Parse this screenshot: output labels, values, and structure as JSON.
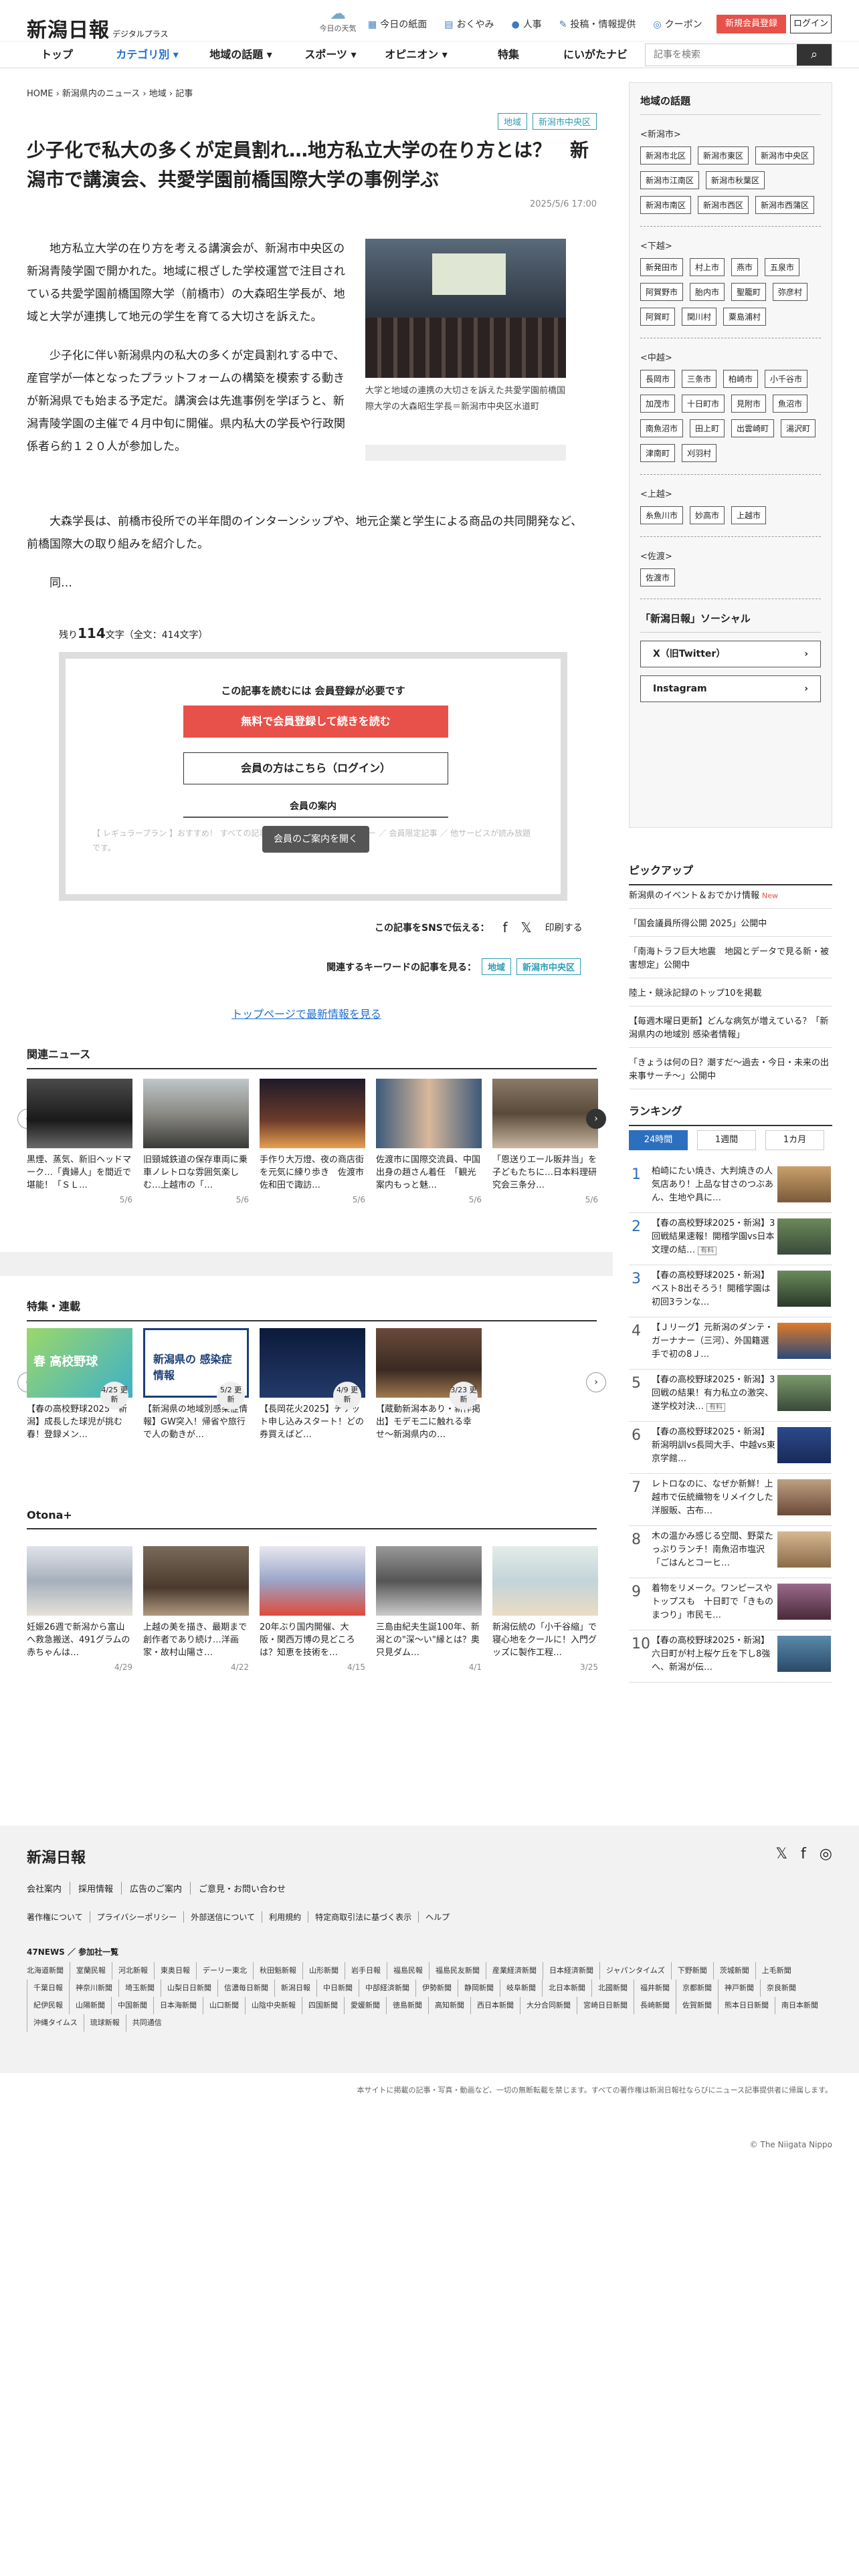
{
  "header": {
    "logo": "新潟日報",
    "logo_sub": "デジタルプラス",
    "weather": "今日の天気",
    "links": [
      {
        "icon": "▦",
        "label": "今日の紙面"
      },
      {
        "icon": "▤",
        "label": "おくやみ"
      },
      {
        "icon": "●",
        "label": "人事"
      },
      {
        "icon": "✎",
        "label": "投稿・情報提供"
      },
      {
        "icon": "◎",
        "label": "クーポン"
      }
    ],
    "register": "新規会員登録",
    "login": "ログイン"
  },
  "nav": {
    "items": [
      "トップ",
      "カテゴリ別 ▾",
      "地域の話題 ▾",
      "スポーツ ▾",
      "オピニオン ▾",
      "特集",
      "にいがたナビ"
    ],
    "search_placeholder": "記事を検索",
    "search_icon": "search-icon"
  },
  "article": {
    "breadcrumb": [
      "HOME",
      "新潟県内のニュース",
      "地域",
      "記事"
    ],
    "tags": [
      "地域",
      "新潟市中央区"
    ],
    "title": "少子化で私大の多くが定員割れ…地方私立大学の在り方とは？　新潟市で講演会、共愛学園前橋国際大学の事例学ぶ",
    "date": "2025/5/6 17:00",
    "p1": "地方私立大学の在り方を考える講演会が、新潟市中央区の新潟青陵学園で開かれた。地域に根ざした学校運営で注目されている共愛学園前橋国際大学（前橋市）の大森昭生学長が、地域と大学が連携して地元の学生を育てる大切さを訴えた。",
    "p2": "少子化に伴い新潟県内の私大の多くが定員割れする中で、産官学が一体となったプラットフォームの構築を模索する動きが新潟県でも始まる予定だ。講演会は先進事例を学ぼうと、新潟青陵学園の主催で４月中旬に開催。県内私大の学長や行政関係者ら約１２０人が参加した。",
    "p3": "大森学長は、前橋市役所での半年間のインターンシップや、地元企業と学生による商品の共同開発など、前橋国際大の取り組みを紹介した。",
    "p4": "同…",
    "caption": "大学と地域の連携の大切さを訴えた共愛学園前橋国際大学の大森昭生学長＝新潟市中央区水道町",
    "remain_label": "残り",
    "remain": "114",
    "remain_unit": "文字",
    "total": "（全文：414文字）"
  },
  "paywall": {
    "heading": "この記事を読むには 会員登録が必要です",
    "register_btn": "無料で会員登録して続きを読む",
    "login_btn": "会員の方はこちら（ログイン）",
    "guide": "会員の案内",
    "faded": "【 レギュラープラン 】おすすめ！ すべての記事が読み放題 ／ 紙面ビューアー ／ 会員限定記事 ／ 他サービスが読み放題です。",
    "open_btn": "会員のご案内を開く"
  },
  "share": {
    "label": "この記事をSNSで伝える：",
    "fb": "f",
    "x": "𝕏",
    "print": "印刷する"
  },
  "keywords": {
    "label": "関連するキーワードの記事を見る：",
    "items": [
      "地域",
      "新潟市中央区"
    ]
  },
  "toplink": "トップページで最新情報を見る",
  "related": {
    "heading": "関連ニュース",
    "items": [
      {
        "text": "黒煙、蒸気、新旧ヘッドマーク…「貴婦人」を間近で堪能！「ＳＬ…",
        "date": "5/6"
      },
      {
        "text": "旧頸城鉄道の保存車両に乗車ノレトロな雰囲気楽しむ…上越市の「…",
        "date": "5/6"
      },
      {
        "text": "手作り大万燈、夜の商店街を元気に練り歩き　佐渡市佐和田で諏訪…",
        "date": "5/6"
      },
      {
        "text": "佐渡市に国際交流員、中国出身の趙さん着任　「観光案内もっと魅…",
        "date": "5/6"
      },
      {
        "text": "「恩送りエール販井当」を子どもたちに…日本料理研究会三条分…",
        "date": "5/6"
      }
    ]
  },
  "features": {
    "heading": "特集・連載",
    "items": [
      {
        "text": "【春の高校野球2025・新潟】成長した球児が挑む春！登録メン…",
        "badge": "4/25 更新"
      },
      {
        "text": "【新潟県の地域別感染症情報】GW突入！帰省や旅行で人の動きが…",
        "badge": "5/2 更新"
      },
      {
        "text": "【長岡花火2025】チケット申し込みスタート！どの券買えばど…",
        "badge": "4/9 更新"
      },
      {
        "text": "【蔵動新潟本あり・新作掲出】モデモ二に触れる幸せ〜新潟県内の…",
        "badge": "3/23 更新"
      }
    ]
  },
  "otona": {
    "heading": "Otona+",
    "items": [
      {
        "text": "妊娠26週で新潟から富山へ救急搬送、491グラムの赤ちゃんは…",
        "date": "4/29"
      },
      {
        "text": "上越の美を描き、最期まで創作者であり続け…洋画家・故村山陽さ…",
        "date": "4/22"
      },
      {
        "text": "20年ぶり国内開催、大阪・関西万博の見どころは？知恵を技術を…",
        "date": "4/15"
      },
      {
        "text": "三島由紀夫生誕100年、新潟との\"深～い\"縁とは？奥只見ダム…",
        "date": "4/1"
      },
      {
        "text": "新潟伝統の「小千谷縮」で寝心地をクールに！入門グッズに製作工程…",
        "date": "3/25"
      }
    ]
  },
  "sidebar": {
    "region_heading": "地域の話題",
    "groups": [
      {
        "label": "<新潟市>",
        "chips": [
          "新潟市北区",
          "新潟市東区",
          "新潟市中央区",
          "新潟市江南区",
          "新潟市秋葉区",
          "新潟市南区",
          "新潟市西区",
          "新潟市西蒲区"
        ]
      },
      {
        "label": "<下越>",
        "chips": [
          "新発田市",
          "村上市",
          "燕市",
          "五泉市",
          "阿賀野市",
          "胎内市",
          "聖籠町",
          "弥彦村",
          "阿賀町",
          "関川村",
          "粟島浦村"
        ]
      },
      {
        "label": "<中越>",
        "chips": [
          "長岡市",
          "三条市",
          "柏崎市",
          "小千谷市",
          "加茂市",
          "十日町市",
          "見附市",
          "魚沼市",
          "南魚沼市",
          "田上町",
          "出雲崎町",
          "湯沢町",
          "津南町",
          "刈羽村"
        ]
      },
      {
        "label": "<上越>",
        "chips": [
          "糸魚川市",
          "妙高市",
          "上越市"
        ]
      },
      {
        "label": "<佐渡>",
        "chips": [
          "佐渡市"
        ]
      }
    ],
    "social_heading": "「新潟日報」ソーシャル",
    "social": [
      {
        "label": "X（旧Twitter）",
        "arrow": "›"
      },
      {
        "label": "Instagram",
        "arrow": "›"
      }
    ],
    "pickup_heading": "ピックアップ",
    "pickup": [
      {
        "text": "新潟県のイベント＆おでかけ情報",
        "new": "New"
      },
      {
        "text": "「国会議員所得公開 2025」公開中",
        "new": ""
      },
      {
        "text": "「南海トラフ巨大地震　地図とデータで見る新・被害想定」公開中",
        "new": ""
      },
      {
        "text": "陸上・競泳記録のトップ10を掲載",
        "new": ""
      },
      {
        "text": "【毎週木曜日更新】どんな病気が増えている？「新潟県内の地域別 感染者情報」",
        "new": ""
      },
      {
        "text": "「きょうは何の日？潮すだ～過去・今日・未来の出来事サーチ～」公開中",
        "new": ""
      }
    ],
    "ranking_heading": "ランキング",
    "ranking_tabs": [
      "24時間",
      "1週間",
      "1カ月"
    ],
    "ranking": [
      {
        "n": "1",
        "text": "柏崎にたい焼き、大判焼きの人気店あり！上品な甘さのつぶあん、生地や具に…",
        "paid": ""
      },
      {
        "n": "2",
        "text": "【春の高校野球2025・新潟】3回戦結果速報！開稽学園vs日本文理の結…",
        "paid": "有料"
      },
      {
        "n": "3",
        "text": "【春の高校野球2025・新潟】ベスト8出そろう！開稽学園は初回3ランな…",
        "paid": ""
      },
      {
        "n": "4",
        "text": "【Ｊリーグ】元新潟のダンテ・ガーナナー（三河）、外国籍選手で初の8Ｊ…",
        "paid": ""
      },
      {
        "n": "5",
        "text": "【春の高校野球2025・新潟】3回戦の結果！有力私立の激突、遂学校対決…",
        "paid": "有料"
      },
      {
        "n": "6",
        "text": "【春の高校野球2025・新潟】新潟明訓vs長岡大手、中越vs東京学館…",
        "paid": ""
      },
      {
        "n": "7",
        "text": "レトロなのに、なぜか新鮮！上越市で伝統織物をリメイクした洋服販、古布…",
        "paid": ""
      },
      {
        "n": "8",
        "text": "木の温かみ感じる空間、野菜たっぷりランチ！南魚沼市塩沢「ごはんとコーヒ…",
        "paid": ""
      },
      {
        "n": "9",
        "text": "着物をリメーク。ワンピースやトップスも　十日町で「きものまつり」市民モ…",
        "paid": ""
      },
      {
        "n": "10",
        "text": "【春の高校野球2025・新潟】六日町が村上桜ケ丘を下し8強へ、新潟が伝…",
        "paid": ""
      }
    ]
  },
  "footer": {
    "logo": "新潟日報",
    "icons": [
      "𝕏",
      "f",
      "◎"
    ],
    "links1": [
      "会社案内",
      "採用情報",
      "広告のご案内",
      "ご意見・お問い合わせ"
    ],
    "links2": [
      "著作権について",
      "プライバシーポリシー",
      "外部送信について",
      "利用規約",
      "特定商取引法に基づく表示",
      "ヘルプ"
    ],
    "news47": "47NEWS ／ 参加社一覧",
    "papers": [
      "北海道新聞",
      "室蘭民報",
      "河北新報",
      "東奥日報",
      "デーリー東北",
      "秋田魁新報",
      "山形新聞",
      "岩手日報",
      "福島民報",
      "福島民友新聞",
      "産業経済新聞",
      "日本経済新聞",
      "ジャパンタイムズ",
      "下野新聞",
      "茨城新聞",
      "上毛新聞",
      "千葉日報",
      "神奈川新聞",
      "埼玉新聞",
      "山梨日日新聞",
      "信濃毎日新聞",
      "新潟日報",
      "中日新聞",
      "中部経済新聞",
      "伊勢新聞",
      "静岡新聞",
      "岐阜新聞",
      "北日本新聞",
      "北國新聞",
      "福井新聞",
      "京都新聞",
      "神戸新聞",
      "奈良新聞",
      "紀伊民報",
      "山陽新聞",
      "中国新聞",
      "日本海新聞",
      "山口新聞",
      "山陰中央新報",
      "四国新聞",
      "愛媛新聞",
      "徳島新聞",
      "高知新聞",
      "西日本新聞",
      "大分合同新聞",
      "宮崎日日新聞",
      "長崎新聞",
      "佐賀新聞",
      "熊本日日新聞",
      "南日本新聞",
      "沖縄タイムス",
      "琉球新報",
      "共同通信"
    ],
    "copy": "本サイトに掲載の記事・写真・動画など、一切の無断転載を禁じます。すべての著作権は新潟日報社ならびにニュース記事提供者に帰属します。",
    "copyright": "© The Niigata Nippo"
  }
}
